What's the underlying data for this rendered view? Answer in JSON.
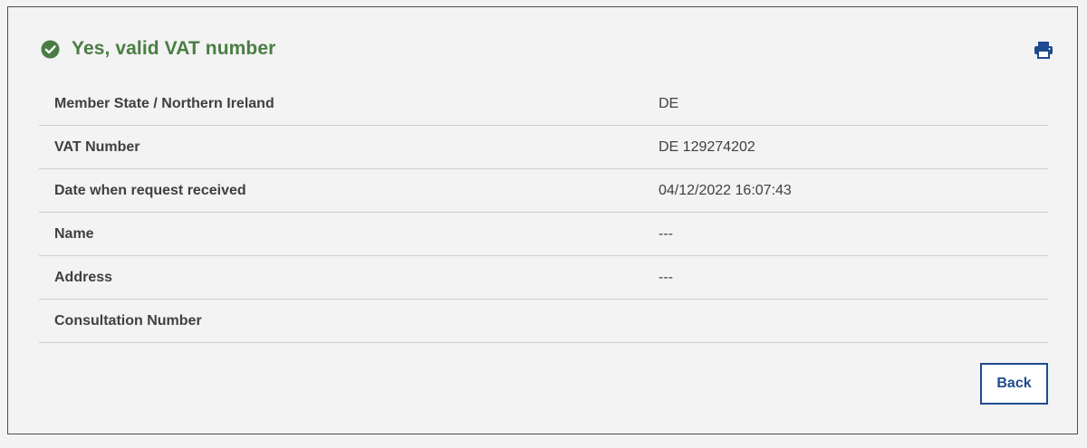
{
  "header": {
    "title": "Yes, valid VAT number",
    "status_icon": "check-circle-icon",
    "status_color": "#4a7d44",
    "print_icon": "printer-icon"
  },
  "details": [
    {
      "label": "Member State / Northern Ireland",
      "value": "DE"
    },
    {
      "label": "VAT Number",
      "value": "DE 129274202"
    },
    {
      "label": "Date when request received",
      "value": "04/12/2022 16:07:43"
    },
    {
      "label": "Name",
      "value": "---"
    },
    {
      "label": "Address",
      "value": "---"
    },
    {
      "label": "Consultation Number",
      "value": ""
    }
  ],
  "actions": {
    "back_label": "Back"
  },
  "colors": {
    "accent": "#1f4b8f",
    "success": "#4a7d44",
    "background": "#f3f3f3"
  }
}
